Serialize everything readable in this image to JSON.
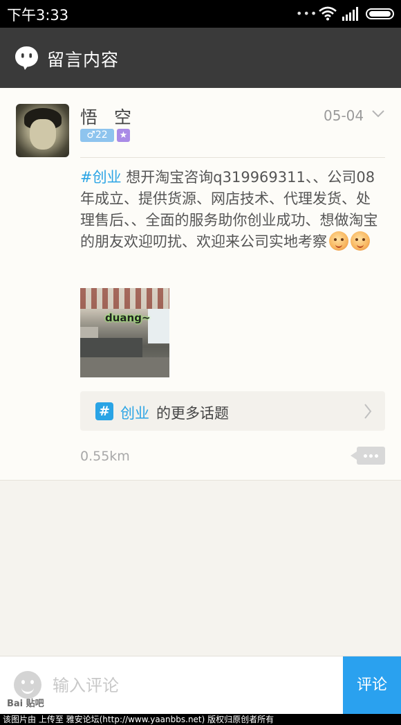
{
  "status_bar": {
    "time": "下午3:33",
    "more": "•••"
  },
  "header": {
    "title": "留言内容",
    "icon": "chat-bubble-icon"
  },
  "post": {
    "author": "悟空",
    "gender_age": "♂22",
    "badge": "★",
    "date": "05-04",
    "topic_tag": "#创业",
    "body": " 想开淘宝咨询q319969311、、公司08年成立、提供货源、网店技术、代理发货、处理售后、、全面的服务助你创业成功、想做淘宝的朋友欢迎叨扰、欢迎来公司实地考察",
    "emoji_count": 2,
    "image_overlay_text": "duang~",
    "topic_link": {
      "hash": "#",
      "name": "创业",
      "suffix": "的更多话题"
    },
    "distance": "0.55km"
  },
  "input_bar": {
    "placeholder": "输入评论",
    "submit_label": "评论"
  },
  "watermark": {
    "logo": "Bai 贴吧",
    "text": "该图片由  上传至 雅安论坛(http://www.yaanbbs.net) 版权归原创者所有"
  },
  "colors": {
    "accent": "#2aa4e5",
    "header_bg": "#3a3a3a",
    "submit_bg": "#2aa1ef"
  }
}
